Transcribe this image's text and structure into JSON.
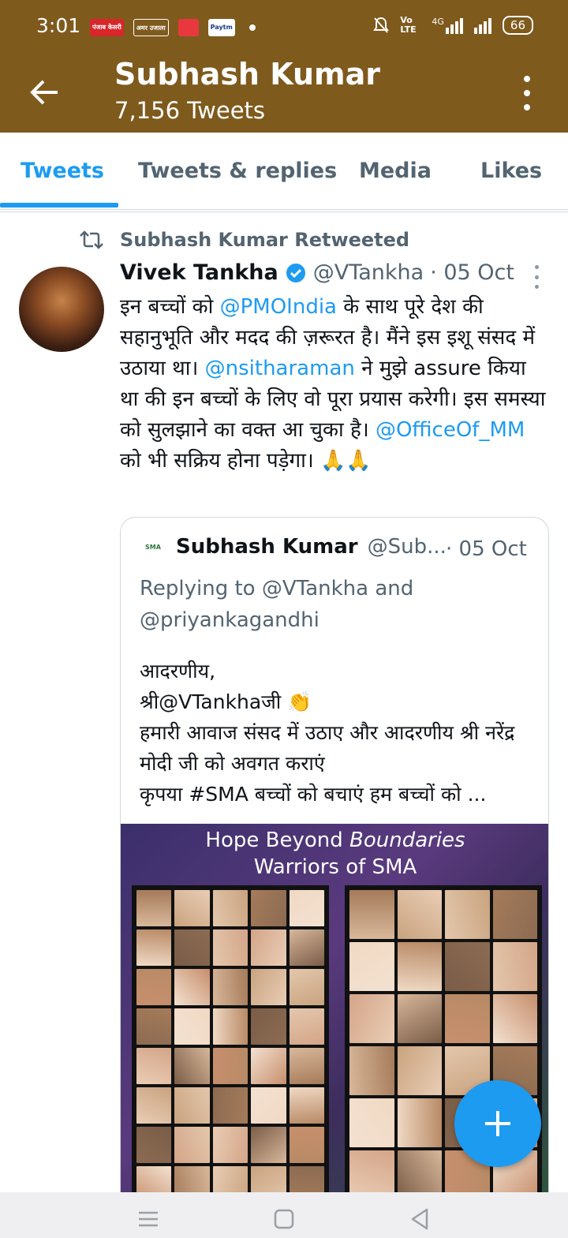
{
  "status_bar": {
    "time": "3:01",
    "apps": [
      {
        "name": "news-app-1",
        "label": "पंजाब केसरी",
        "color": "#d8262b"
      },
      {
        "name": "news-app-2",
        "label": "अमर उजाला",
        "color": "#7f5a1d"
      },
      {
        "name": "news-app-3",
        "label": "",
        "color": "#e8383d"
      },
      {
        "name": "news-app-4",
        "label": "Paytm",
        "color": "#ffffff"
      }
    ],
    "network_label": "Vo LTE",
    "network_gen": "4G",
    "battery": "66"
  },
  "app_bar": {
    "title": "Subhash Kumar",
    "subtitle": "7,156 Tweets"
  },
  "tabs": [
    {
      "label": "Tweets",
      "active": true
    },
    {
      "label": "Tweets & replies",
      "active": false
    },
    {
      "label": "Media",
      "active": false
    },
    {
      "label": "Likes",
      "active": false
    }
  ],
  "tweet": {
    "retweet_label": "Subhash Kumar Retweeted",
    "author_name": "Vivek Tankha",
    "handle": "@VTankha",
    "date": "· 05 Oct",
    "body": {
      "p1": "इन बच्चों को ",
      "m1": "@PMOIndia",
      "p2": " के साथ पूरे देश की सहानुभूति और मदद की ज़रूरत है। मैंने इस इशू संसद में उठाया था। ",
      "m2": "@nsitharaman",
      "p3": " ने मुझे assure किया था की इन बच्चों के लिए वो पूरा प्रयास करेगी। इस समस्या को सुलझाने का वक्त आ चुका है। ",
      "m3": "@OfficeOf_MM",
      "p4": " को भी सक्रिय होना पड़ेगा। 🙏🙏"
    }
  },
  "quoted_tweet": {
    "logo_text": "SMA",
    "author_name": "Subhash Kumar",
    "handle": "@Sub...",
    "date": "· 05 Oct",
    "replying_to": "Replying to @VTankha and @priyankagandhi",
    "text": "आदरणीय,\nश्री@VTankhaजी 👏\nहमारी आवाज संसद में उठाए और आदरणीय श्री नरेंद्र मोदी जी को अवगत कराएं\nकृपया #SMA बच्चों को बचाएं हम बच्चों को ...",
    "image_title_italic_a": "Hope Beyond",
    "image_title_italic_b": "Boundaries",
    "image_subtitle": "Warriors of SMA"
  },
  "colors": {
    "header": "#7f5a1d",
    "accent": "#1d9bf0",
    "muted": "#536471"
  }
}
